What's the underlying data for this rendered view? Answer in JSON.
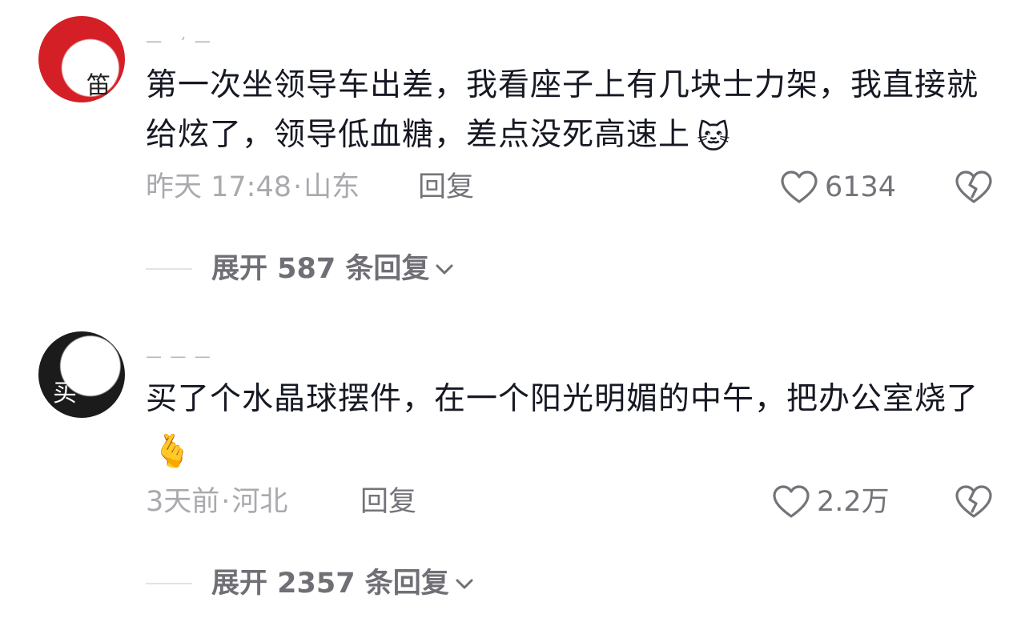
{
  "comments": [
    {
      "avatar_chars": "笛",
      "username": "一 乛 一",
      "text": "第一次坐领导车出差，我看座子上有几块士力架，我直接就给炫了，领导低血糖，差点没死高速上",
      "emoji": "🐱",
      "time": "昨天 17:48",
      "separator": "·",
      "location": "山东",
      "reply_label": "回复",
      "likes": "6134",
      "expand_label": "展开 587 条回复"
    },
    {
      "avatar_chars": "买",
      "username": "— — —",
      "text": "买了个水晶球摆件，在一个阳光明媚的中午，把办公室烧了",
      "emoji": "🫰",
      "time": "3天前",
      "separator": "·",
      "location": "河北",
      "reply_label": "回复",
      "likes": "2.2万",
      "expand_label": "展开 2357 条回复"
    }
  ],
  "icons": {
    "like": "heart-outline-icon",
    "dislike": "broken-heart-icon",
    "expand": "chevron-down-icon"
  },
  "colors": {
    "text": "#161823",
    "meta": "#a9a9ae",
    "action": "#737379"
  }
}
